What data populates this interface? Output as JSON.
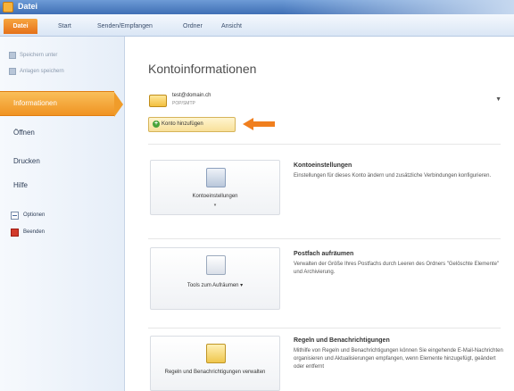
{
  "titlebar": {
    "title": "Datei"
  },
  "tabs": [
    {
      "label": "Datei"
    },
    {
      "label": "Start"
    },
    {
      "label": "Senden/Empfangen"
    },
    {
      "label": "Ordner"
    },
    {
      "label": "Ansicht"
    }
  ],
  "sidebar": {
    "commands": [
      {
        "label": "Speichern unter"
      },
      {
        "label": "Anlagen speichern"
      }
    ],
    "active": "Informationen",
    "items": [
      "Öffnen",
      "Drucken",
      "Hilfe"
    ],
    "sub": [
      {
        "label": "Optionen"
      },
      {
        "label": "Beenden"
      }
    ]
  },
  "main": {
    "title": "Kontoinformationen",
    "account": {
      "email": "test@domain.ch",
      "type": "POP/SMTP",
      "dropdown": "▼"
    },
    "add_account": "Konto hinzufügen",
    "sections": [
      {
        "button": "Kontoeinstellungen",
        "caret": "▾",
        "heading": "Kontoeinstellungen",
        "description": "Einstellungen für dieses Konto ändern und zusätzliche Verbindungen konfigurieren."
      },
      {
        "button": "Tools zum Aufräumen ▾",
        "heading": "Postfach aufräumen",
        "description": "Verwalten der Größe Ihres Postfachs durch Leeren des Ordners \"Gelöschte Elemente\" und Archivierung."
      },
      {
        "button": "Regeln und Benachrichtigungen verwalten",
        "heading": "Regeln und Benachrichtigungen",
        "description": "Mithilfe von Regeln und Benachrichtigungen können Sie eingehende E-Mail-Nachrichten organisieren und Aktualisierungen empfangen, wenn Elemente hinzugefügt, geändert oder entfernt"
      }
    ]
  },
  "colors": {
    "accent": "#f09322",
    "file_tab": "#e5711a",
    "arrow": "#f07f1e"
  }
}
